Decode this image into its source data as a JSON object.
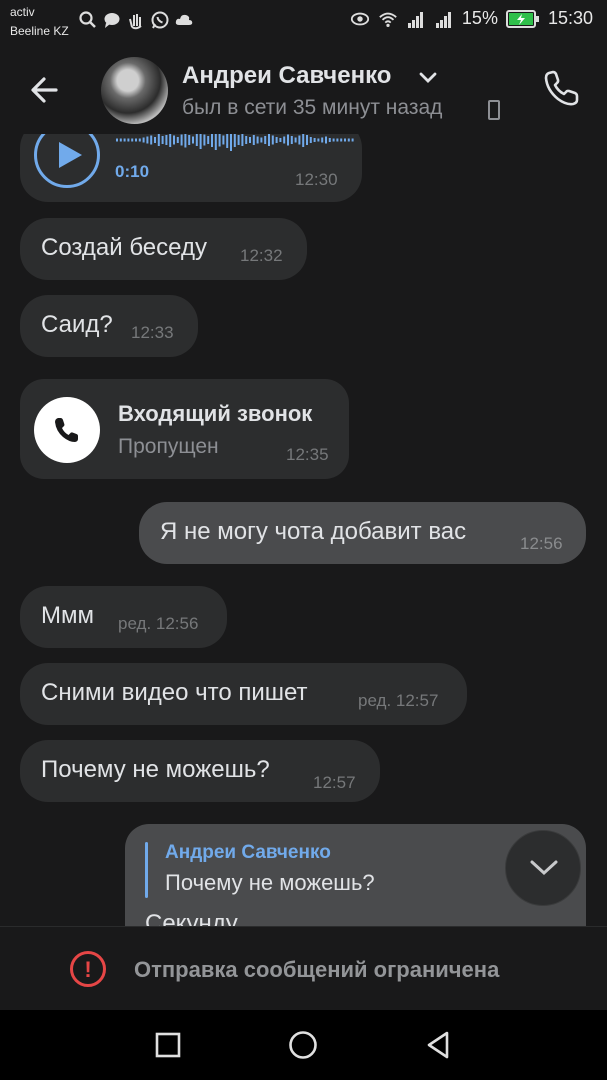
{
  "status_bar": {
    "carrier_top": "activ",
    "carrier_bottom": "Beeline KZ",
    "battery_percent": "15%",
    "time": "15:30",
    "left_icons": [
      "search-icon",
      "chat-bubble-icon",
      "gesture-icon",
      "whatsapp-icon",
      "cloud-icon"
    ],
    "right_icons": [
      "eye-icon",
      "wifi-icon",
      "signal-icon",
      "signal-icon",
      "battery-charging-icon"
    ]
  },
  "header": {
    "contact_name": "Андреи Савченко",
    "last_seen": "был в сети 35 минут назад"
  },
  "messages": [
    {
      "kind": "voice",
      "duration": "0:10",
      "time": "12:30"
    },
    {
      "kind": "text",
      "direction": "in",
      "text": "Создай беседу",
      "time": "12:32"
    },
    {
      "kind": "text",
      "direction": "in",
      "text": "Саид?",
      "time": "12:33"
    },
    {
      "kind": "call",
      "title": "Входящий звонок",
      "status": "Пропущен",
      "time": "12:35"
    },
    {
      "kind": "text",
      "direction": "out",
      "text": "Я не могу чота добавит вас",
      "time": "12:56"
    },
    {
      "kind": "text",
      "direction": "in",
      "text": "Ммм",
      "time": "ред. 12:56"
    },
    {
      "kind": "text",
      "direction": "in",
      "text": "Сними видео что пишет",
      "time": "ред. 12:57"
    },
    {
      "kind": "text",
      "direction": "in",
      "text": "Почему не можешь?",
      "time": "12:57"
    },
    {
      "kind": "reply",
      "direction": "out",
      "reply_author": "Андреи Савченко",
      "reply_text": "Почему не можешь?",
      "text": "Секунду"
    }
  ],
  "restriction": {
    "text": "Отправка сообщений ограничена"
  },
  "colors": {
    "background": "#19191a",
    "bubble_in": "#2c2d2e",
    "bubble_out": "#4a4b4d",
    "accent": "#71aaeb",
    "error": "#e64646"
  }
}
